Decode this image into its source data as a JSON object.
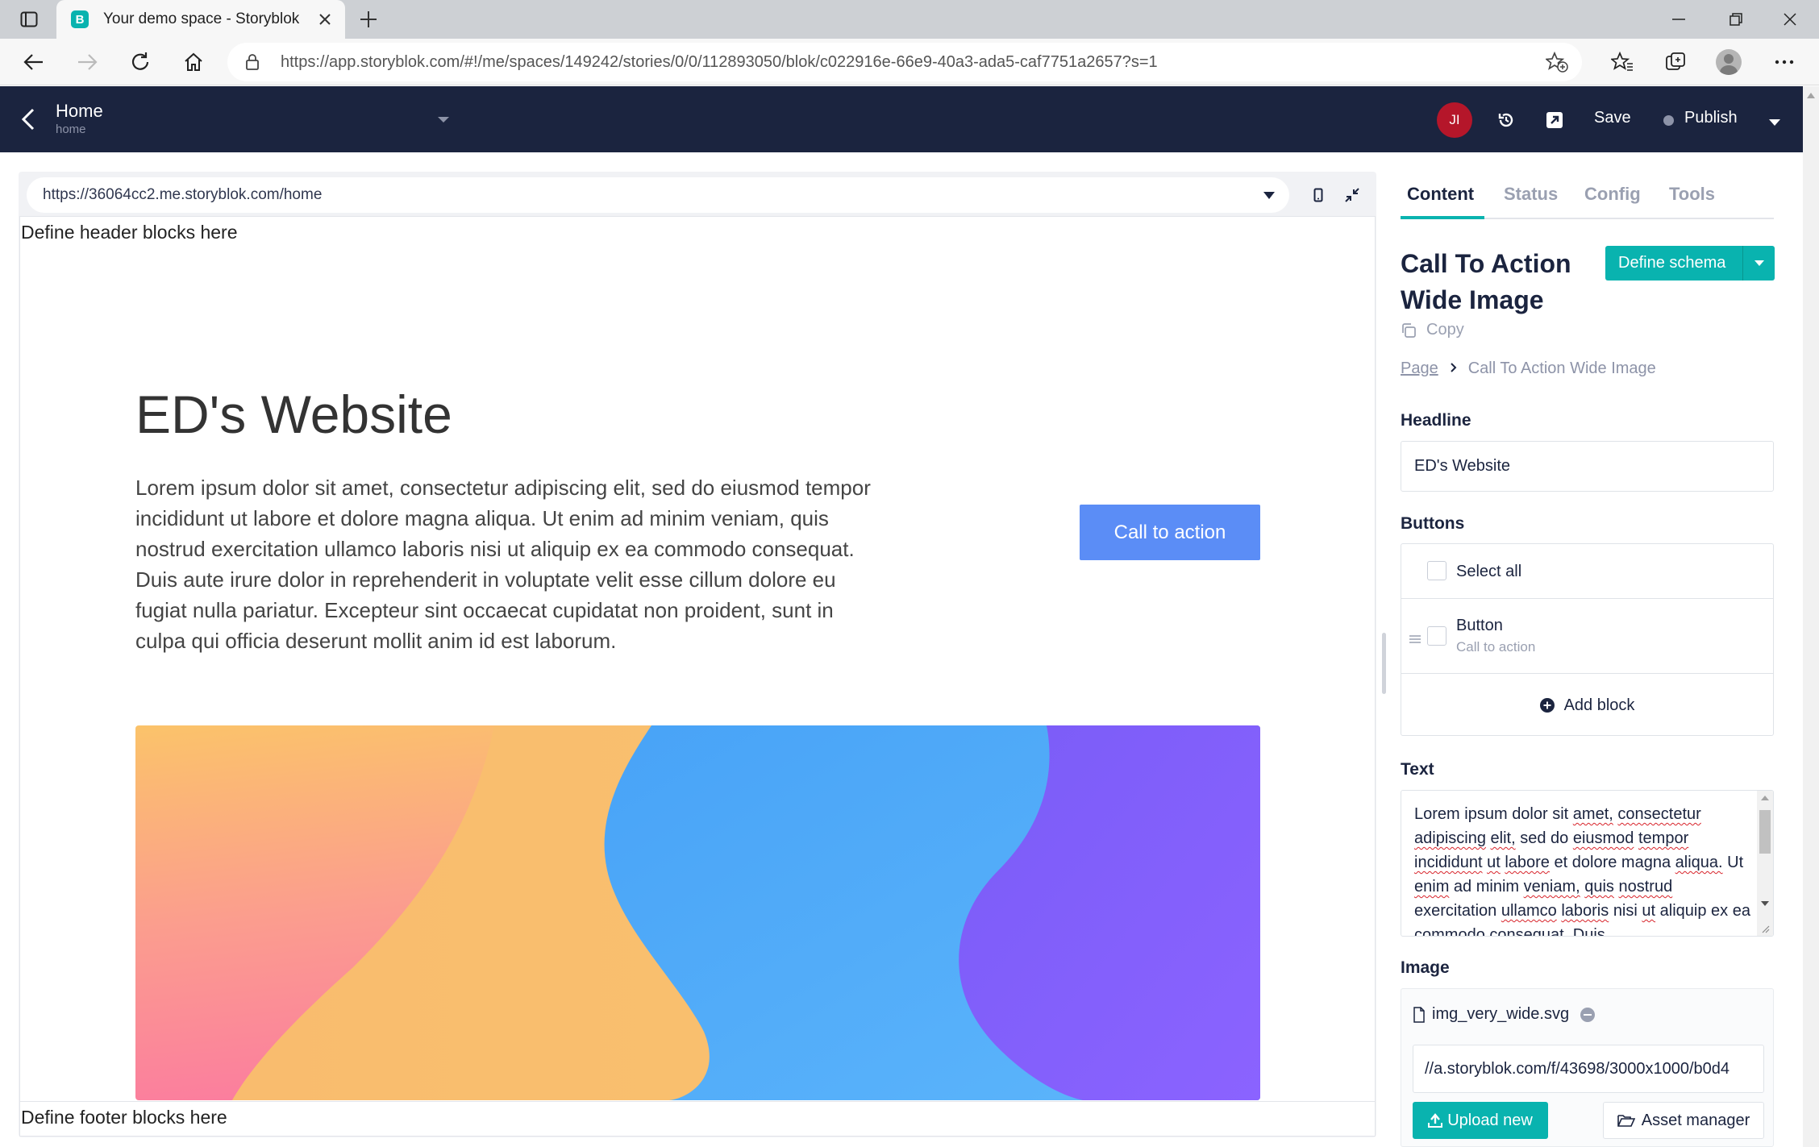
{
  "browser": {
    "tab_title": "Your demo space - Storyblok",
    "favicon_letter": "B",
    "address": "https://app.storyblok.com/#!/me/spaces/149242/stories/0/0/112893050/blok/c022916e-66e9-40a3-ada5-caf7751a2657?s=1"
  },
  "header": {
    "story_title": "Home",
    "story_slug": "home",
    "user_initials": "JI",
    "save_label": "Save",
    "publish_label": "Publish"
  },
  "preview": {
    "url": "https://36064cc2.me.storyblok.com/home",
    "header_blocks_text": "Define header blocks here",
    "site_title": "ED's Website",
    "site_text": "Lorem ipsum dolor sit amet, consectetur adipiscing elit, sed do eiusmod tempor incididunt ut labore et dolore magna aliqua. Ut enim ad minim veniam, quis nostrud exercitation ullamco laboris nisi ut aliquip ex ea commodo consequat. Duis aute irure dolor in reprehenderit in voluptate velit esse cillum dolore eu fugiat nulla pariatur. Excepteur sint occaecat cupidatat non proident, sunt in culpa qui officia deserunt mollit anim id est laborum.",
    "cta_label": "Call to action",
    "footer_blocks_text": "Define footer blocks here"
  },
  "panel": {
    "tabs": [
      {
        "label": "Content"
      },
      {
        "label": "Status"
      },
      {
        "label": "Config"
      },
      {
        "label": "Tools"
      }
    ],
    "block_title": "Call To Action Wide Image",
    "define_schema_label": "Define schema",
    "copy_label": "Copy",
    "breadcrumb": {
      "parent": "Page",
      "current": "Call To Action Wide Image"
    },
    "headline_label": "Headline",
    "headline_value": "ED's Website",
    "buttons_label": "Buttons",
    "select_all_label": "Select all",
    "button_item": {
      "title": "Button",
      "subtitle": "Call to action"
    },
    "add_block_label": "Add block",
    "text_label": "Text",
    "text_words": [
      "Lorem",
      "ipsum",
      "dolor",
      "sit",
      "amet,",
      "consectetur",
      "adipiscing",
      "elit,",
      "sed",
      "do",
      "eiusmod",
      "tempor",
      "incididunt",
      "ut",
      "labore",
      "et",
      "dolore",
      "magna",
      "aliqua.",
      "Ut",
      "enim",
      "ad",
      "minim",
      "veniam,",
      "quis",
      "nostrud",
      "exercitation",
      "ullamco",
      "laboris",
      "nisi",
      "ut",
      "aliquip",
      "ex",
      "ea",
      "commodo",
      "consequat.",
      "Duis"
    ],
    "image_label": "Image",
    "image_filename": "img_very_wide.svg",
    "image_url": "//a.storyblok.com/f/43698/3000x1000/b0d4",
    "upload_label": "Upload new",
    "asset_manager_label": "Asset manager"
  },
  "colors": {
    "accent": "#09b3af",
    "header_bg": "#1b243f",
    "cta_blue": "#5b8df6",
    "avatar_red": "#b5162a"
  }
}
